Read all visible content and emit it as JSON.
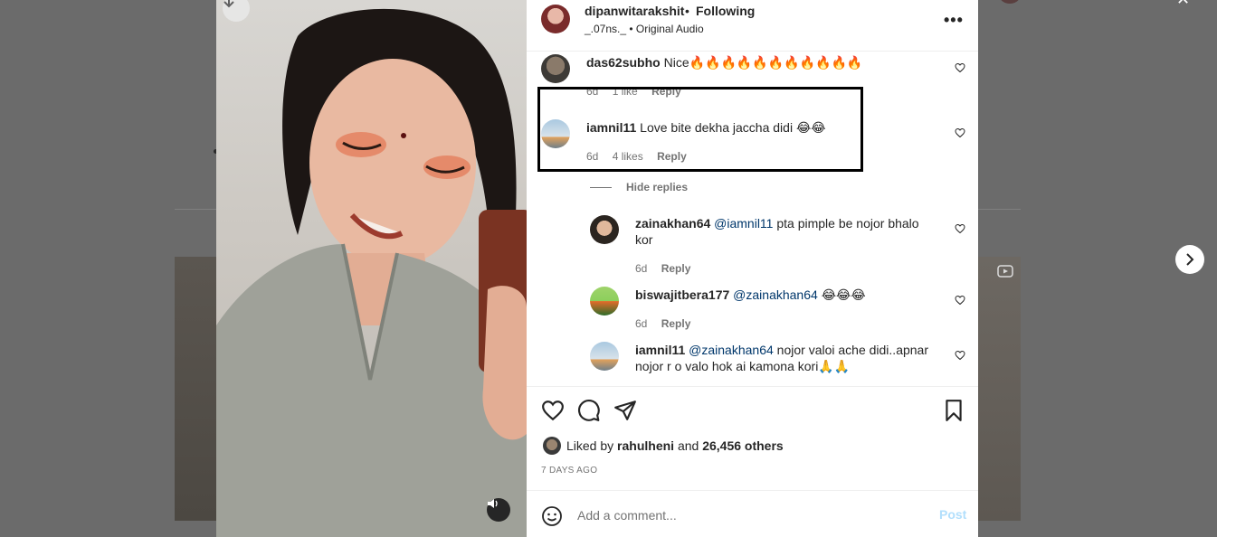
{
  "post": {
    "username": "dipanwitarakshit",
    "separator": "•",
    "follow_status": "Following",
    "audio": "_.07ns._ • Original Audio",
    "more_label": "•••"
  },
  "comments": [
    {
      "username": "das62subho",
      "text": "Nice🔥🔥🔥🔥🔥🔥🔥🔥🔥🔥🔥",
      "age": "6d",
      "likes": "1 like",
      "reply_label": "Reply"
    },
    {
      "username": "iamnil11",
      "text": "Love bite dekha jaccha didi 😂😂",
      "age": "6d",
      "likes": "4 likes",
      "reply_label": "Reply"
    }
  ],
  "hide_replies_label": "Hide replies",
  "replies": [
    {
      "username": "zainakhan64",
      "mention": "@iamnil11",
      "text_line1": "pta pimple be nojor bhalo",
      "text_line2": "kor",
      "age": "6d",
      "reply_label": "Reply"
    },
    {
      "username": "biswajitbera177",
      "mention": "@zainakhan64",
      "text_line1": "😂😂😂",
      "age": "6d",
      "reply_label": "Reply"
    },
    {
      "username": "iamnil11",
      "mention": "@zainakhan64",
      "text_line1": "nojor valoi ache didi..apnar",
      "text_line2": "nojor r o valo hok ai kamona kori🙏🙏"
    }
  ],
  "likes": {
    "prefix": "Liked by",
    "user": "rahulheni",
    "middle": "and",
    "others": "26,456 others"
  },
  "time_ago": "7 DAYS AGO",
  "add_comment": {
    "placeholder": "Add a comment...",
    "post_label": "Post"
  },
  "colors": {
    "link_blue": "#00376b",
    "post_disabled": "#b2dffc",
    "highlight_border": "#000000"
  }
}
